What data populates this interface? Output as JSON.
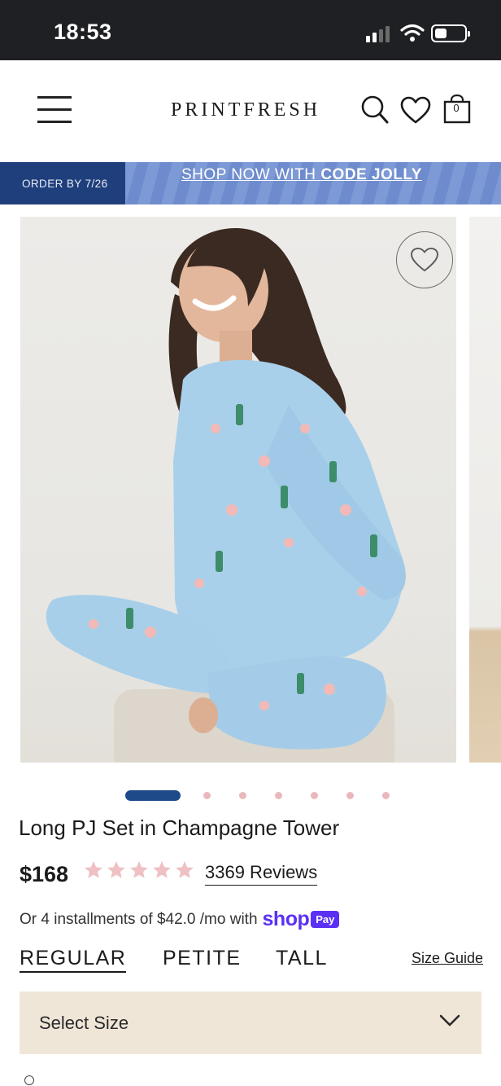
{
  "status_bar": {
    "time": "18:53",
    "signal_icon": "signal-bars-icon",
    "wifi_icon": "wifi-icon",
    "battery_icon": "battery-icon"
  },
  "header": {
    "brand": "PRINTFRESH",
    "menu_icon": "hamburger-menu-icon",
    "search_icon": "search-icon",
    "wishlist_icon": "heart-icon",
    "cart_icon": "shopping-bag-icon",
    "cart_count": "0"
  },
  "promo": {
    "order_by": "ORDER BY 7/26",
    "cta_prefix": "SHOP NOW WITH ",
    "cta_code": "CODE JOLLY",
    "colors": {
      "left_bg": "#1f3f7c",
      "right_bg": "#7d99d6"
    }
  },
  "gallery": {
    "wishlist_icon": "heart-outline-icon",
    "image_count": 7,
    "active_index": 0
  },
  "product": {
    "title": "Long PJ Set in Champagne Tower",
    "price": "$168",
    "rating": 5,
    "reviews": "3369 Reviews",
    "installments_prefix": "Or 4 installments of $42.0 /mo with",
    "shop_label": "shop",
    "pay_label": "Pay"
  },
  "fit": {
    "options": [
      "REGULAR",
      "PETITE",
      "TALL"
    ],
    "selected": "REGULAR",
    "size_guide": "Size Guide"
  },
  "size_select": {
    "placeholder": "Select Size",
    "chevron_icon": "chevron-down-icon"
  },
  "colors": {
    "accent": "#1f4a8a",
    "star": "#efc0c4",
    "select_bg": "#f0e6d8",
    "shop_pay": "#5a31f4"
  }
}
